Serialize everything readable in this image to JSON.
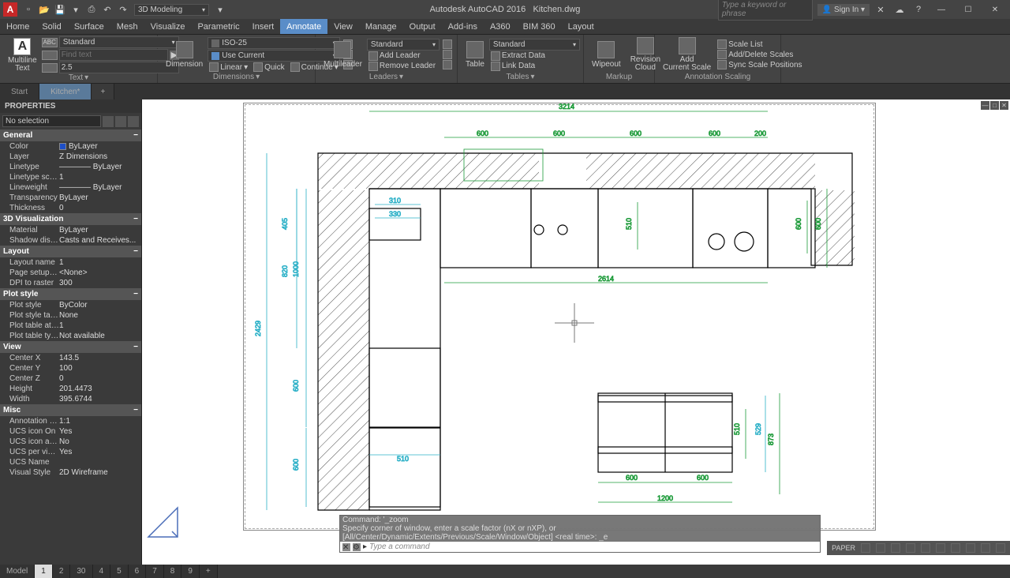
{
  "title": {
    "app": "Autodesk AutoCAD 2016",
    "file": "Kitchen.dwg"
  },
  "workspace": "3D Modeling",
  "search_ph": "Type a keyword or phrase",
  "signin": "Sign In",
  "menu": [
    "Home",
    "Solid",
    "Surface",
    "Mesh",
    "Visualize",
    "Parametric",
    "Insert",
    "Annotate",
    "View",
    "Manage",
    "Output",
    "Add-ins",
    "A360",
    "BIM 360",
    "Layout"
  ],
  "menu_active": 7,
  "ribbon": {
    "text": {
      "big": "Multiline\nText",
      "style": "Standard",
      "find_ph": "Find text",
      "height": "2.5",
      "title": "Text"
    },
    "dim": {
      "big": "Dimension",
      "style": "ISO-25",
      "layer": "Use Current",
      "linear": "Linear",
      "quick": "Quick",
      "continue": "Continue",
      "title": "Dimensions"
    },
    "lead": {
      "big": "Multileader",
      "style": "Standard",
      "add": "Add Leader",
      "remove": "Remove Leader",
      "title": "Leaders"
    },
    "tbl": {
      "big": "Table",
      "style": "Standard",
      "extract": "Extract Data",
      "link": "Link Data",
      "title": "Tables"
    },
    "markup": {
      "wipe": "Wipeout",
      "cloud": "Revision\nCloud",
      "title": "Markup"
    },
    "scale": {
      "add": "Add\nCurrent Scale",
      "list": "Scale List",
      "adddel": "Add/Delete Scales",
      "sync": "Sync Scale Positions",
      "title": "Annotation Scaling"
    }
  },
  "doctabs": {
    "start": "Start",
    "file": "Kitchen*"
  },
  "props": {
    "hdr": "PROPERTIES",
    "sel": "No selection",
    "cats": [
      {
        "n": "General",
        "rows": [
          [
            "Color",
            "ByLayer",
            true
          ],
          [
            "Layer",
            "Z Dimensions"
          ],
          [
            "Linetype",
            "———— ByLayer"
          ],
          [
            "Linetype scale",
            "1"
          ],
          [
            "Lineweight",
            "———— ByLayer"
          ],
          [
            "Transparency",
            "ByLayer"
          ],
          [
            "Thickness",
            "0"
          ]
        ]
      },
      {
        "n": "3D Visualization",
        "rows": [
          [
            "Material",
            "ByLayer"
          ],
          [
            "Shadow display",
            "Casts and Receives..."
          ]
        ]
      },
      {
        "n": "Layout",
        "rows": [
          [
            "Layout name",
            "1"
          ],
          [
            "Page setup na...",
            "<None>"
          ],
          [
            "DPI to raster",
            "300"
          ]
        ]
      },
      {
        "n": "Plot style",
        "rows": [
          [
            "Plot style",
            "ByColor"
          ],
          [
            "Plot style table",
            "None"
          ],
          [
            "Plot table attac...",
            "1"
          ],
          [
            "Plot table type",
            "Not available"
          ]
        ]
      },
      {
        "n": "View",
        "rows": [
          [
            "Center X",
            "143.5"
          ],
          [
            "Center Y",
            "100"
          ],
          [
            "Center Z",
            "0"
          ],
          [
            "Height",
            "201.4473"
          ],
          [
            "Width",
            "395.6744"
          ]
        ]
      },
      {
        "n": "Misc",
        "rows": [
          [
            "Annotation scale",
            "1:1"
          ],
          [
            "UCS icon On",
            "Yes"
          ],
          [
            "UCS icon at ori...",
            "No"
          ],
          [
            "UCS per viewp...",
            "Yes"
          ],
          [
            "UCS Name",
            ""
          ],
          [
            "Visual Style",
            "2D Wireframe"
          ]
        ]
      }
    ]
  },
  "cmd": {
    "l1": "Command: '_zoom",
    "l2": "Specify corner of window, enter a scale factor (nX or nXP), or",
    "l3": "[All/Center/Dynamic/Extents/Previous/Scale/Window/Object] <real time>: _e",
    "ph": "Type a command"
  },
  "layout_tabs": [
    "Model",
    "1",
    "2",
    "30",
    "4",
    "5",
    "6",
    "7",
    "8",
    "9",
    "+"
  ],
  "layout_active": 1,
  "status": {
    "paper": "PAPER"
  },
  "dims": {
    "d3214": "3214",
    "d600": "600",
    "d200": "200",
    "d310": "310",
    "d330": "330",
    "d2614": "2614",
    "d510": "510",
    "d1000": "1000",
    "d820": "820",
    "d405": "405",
    "d2429": "2429",
    "d1200": "1200",
    "d873": "873",
    "d529": "529"
  }
}
